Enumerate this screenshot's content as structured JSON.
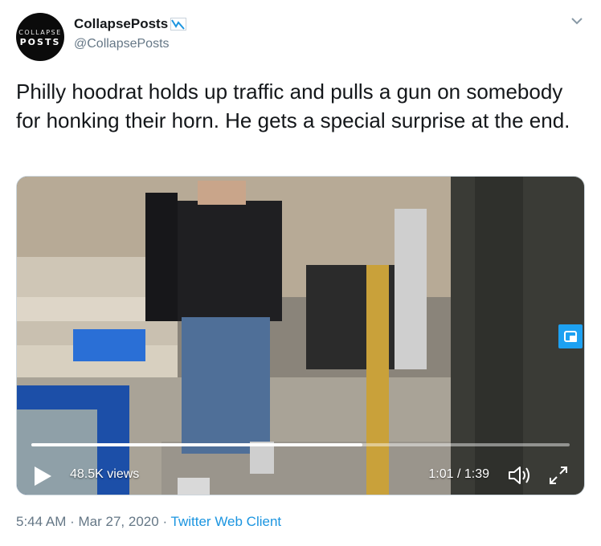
{
  "author": {
    "display_name": "CollapsePosts",
    "handle": "@CollapsePosts",
    "avatar_text_top": "COLLAPSE",
    "avatar_text_bottom": "POSTS",
    "name_icon": "chart-decline-icon"
  },
  "tweet": {
    "text": "Philly hoodrat holds up traffic and pulls a gun on somebody for honking their horn. He gets a special surprise at the end."
  },
  "video": {
    "views": "48.5K views",
    "time": "1:01 / 1:39",
    "progress_fraction": 0.615,
    "controls": [
      "play-icon",
      "volume-icon",
      "fullscreen-icon",
      "picture-in-picture-icon"
    ]
  },
  "meta": {
    "time": "5:44 AM",
    "date": "Mar 27, 2020",
    "separator": "·",
    "client": "Twitter Web Client"
  },
  "colors": {
    "accent": "#1da1f2",
    "link": "#1b95e0",
    "secondary_text": "#657786",
    "primary_text": "#14171a"
  }
}
